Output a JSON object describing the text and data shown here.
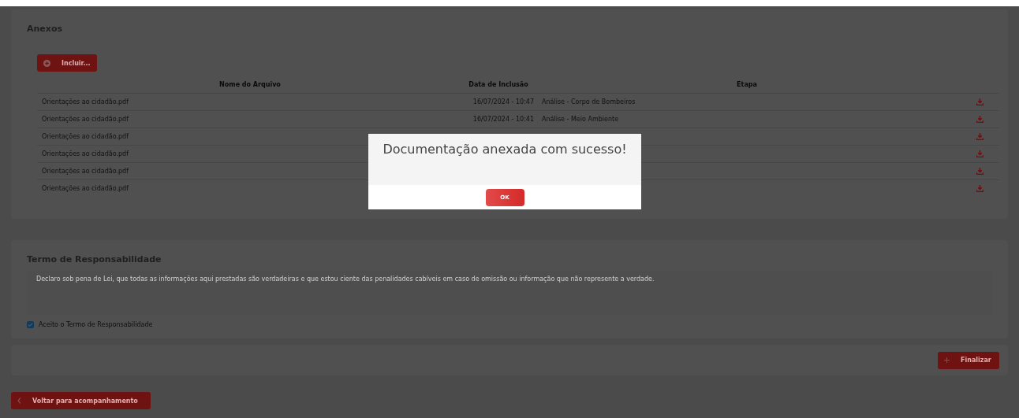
{
  "attachments": {
    "title": "Anexos",
    "add_button": "Incluir...",
    "columns": [
      "Nome do Arquivo",
      "Data de Inclusão",
      "Etapa"
    ],
    "rows": [
      {
        "file": "Orientações ao cidadão.pdf",
        "date": "16/07/2024 - 10:47",
        "stage": "Análise - Corpo de Bombeiros"
      },
      {
        "file": "Orientações ao cidadão.pdf",
        "date": "16/07/2024 - 10:41",
        "stage": "Análise - Meio Ambiente"
      },
      {
        "file": "Orientações ao cidadão.pdf"
      },
      {
        "file": "Orientações ao cidadão.pdf"
      },
      {
        "file": "Orientações ao cidadão.pdf"
      },
      {
        "file": "Orientações ao cidadão.pdf"
      }
    ]
  },
  "terms": {
    "title": "Termo de Responsabilidade",
    "text": "Declaro sob pena de Lei, que todas as informações aqui prestadas são verdadeiras e que estou ciente das penalidades cabíveis em caso de omissão ou informação que não represente a verdade.",
    "accept": {
      "label": "Aceito o Termo de Responsabilidade",
      "checked": true
    }
  },
  "finish_button": "Finalizar",
  "back_button": "Voltar para acompanhamento",
  "dialog": {
    "message": "Documentação anexada com sucesso!",
    "ok_button": "OK"
  }
}
